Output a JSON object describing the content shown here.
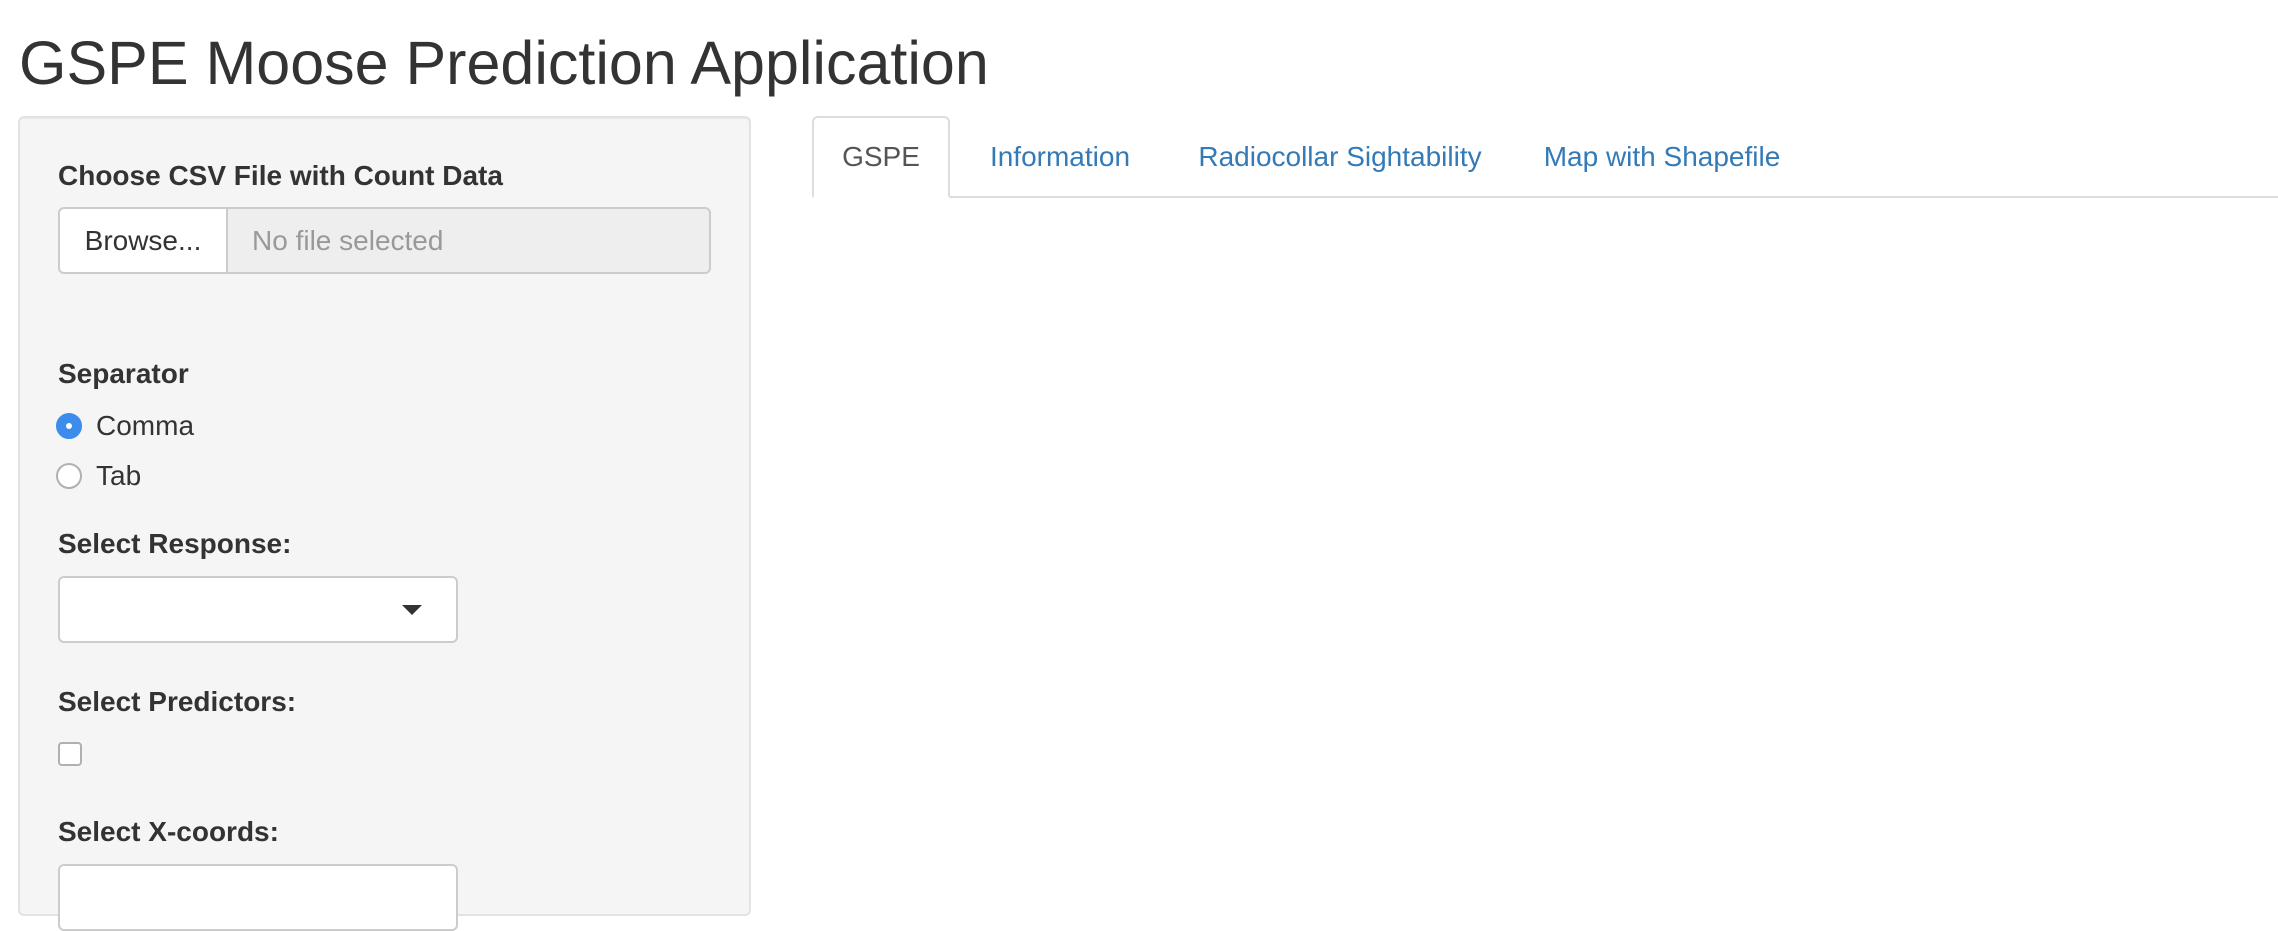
{
  "app": {
    "title": "GSPE Moose Prediction Application"
  },
  "sidebar": {
    "file_input": {
      "label": "Choose CSV File with Count Data",
      "browse_label": "Browse...",
      "placeholder": "No file selected"
    },
    "separator": {
      "label": "Separator",
      "options": [
        {
          "label": "Comma",
          "checked": true
        },
        {
          "label": "Tab",
          "checked": false
        }
      ]
    },
    "response": {
      "label": "Select Response:",
      "value": ""
    },
    "predictors": {
      "label": "Select Predictors:",
      "checked": false
    },
    "xcoords": {
      "label": "Select X-coords:",
      "value": ""
    }
  },
  "tabs": [
    {
      "label": "GSPE",
      "active": true
    },
    {
      "label": "Information",
      "active": false
    },
    {
      "label": "Radiocollar Sightability",
      "active": false
    },
    {
      "label": "Map with Shapefile",
      "active": false
    }
  ],
  "colors": {
    "link": "#337ab7",
    "radio_checked": "#3b8ced",
    "well_background": "#f5f5f5"
  }
}
